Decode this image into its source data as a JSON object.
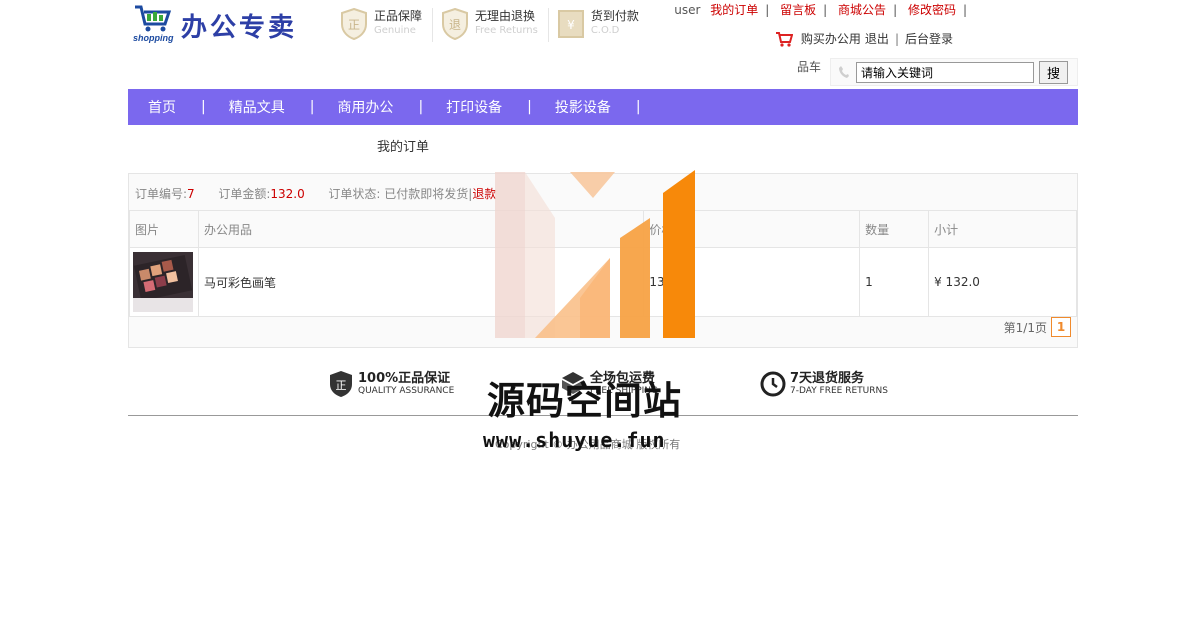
{
  "brand": {
    "shopping_text": "shopping",
    "name": "办公专卖"
  },
  "guarantees": [
    {
      "title": "正品保障",
      "subtitle": "Genuine",
      "badge_char": "正"
    },
    {
      "title": "无理由退换",
      "subtitle": "Free Returns",
      "badge_char": "退"
    },
    {
      "title": "货到付款",
      "subtitle": "C.O.D",
      "badge_char": "¥"
    }
  ],
  "topnav": {
    "user": "user",
    "links": [
      "我的订单",
      "留言板",
      "商城公告",
      "修改密码"
    ],
    "trailing_sep": "|"
  },
  "subnav": {
    "cart_link": "购买办公用",
    "logout": "退出",
    "admin": "后台登录"
  },
  "cart_label": "品车",
  "search": {
    "value": "请输入关键词",
    "button": "搜"
  },
  "mainnav": [
    "首页",
    "精品文具",
    "商用办公",
    "打印设备",
    "投影设备"
  ],
  "page_heading": "我的订单",
  "order": {
    "id_label": "订单编号:",
    "id_value": "7",
    "amount_label": "订单金额:",
    "amount_value": "132.0",
    "status_label": "订单状态:",
    "status_value": "已付款即将发货|",
    "refund_link": "退款"
  },
  "table": {
    "headers": [
      "图片",
      "办公用品",
      "价格",
      "数量",
      "小计"
    ],
    "rows": [
      {
        "name": "马可彩色画笔",
        "price": "132",
        "qty": "1",
        "subtotal": "¥ 132.0"
      }
    ]
  },
  "pager": {
    "label": "第1/1页",
    "current": "1"
  },
  "services": [
    {
      "title": "100%正品保证",
      "subtitle": "QUALITY ASSURANCE"
    },
    {
      "title": "全场包运费",
      "subtitle": "FREE SHIPPING"
    },
    {
      "title": "7天退货服务",
      "subtitle": "7-DAY FREE RETURNS"
    }
  ],
  "copyright": "Copyright © 办公用品商城 版权所有",
  "watermark": {
    "name": "源码空间站",
    "url": "www.shuyue.fun"
  },
  "colors": {
    "nav_bg": "#7b68ee",
    "accent_red": "#cc0000",
    "pager_orange": "#f08a2c",
    "brand_blue": "#2d3fa6"
  }
}
